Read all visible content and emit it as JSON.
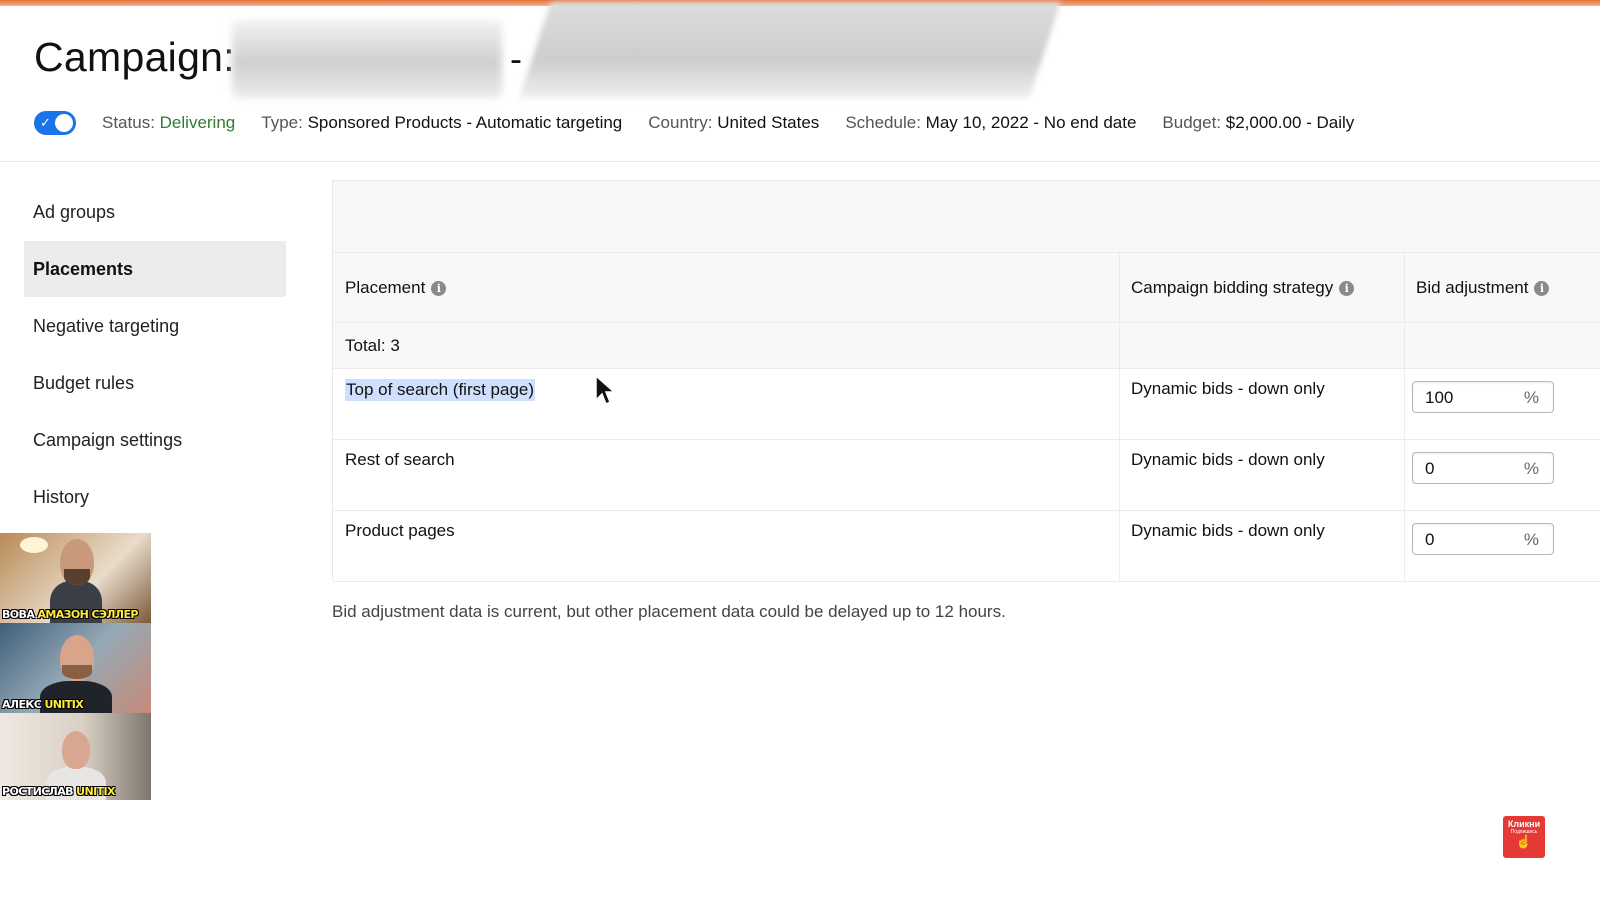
{
  "header": {
    "title": "Campaign:",
    "title_suffix": "-",
    "status_label": "Status:",
    "status_value": "Delivering",
    "type_label": "Type:",
    "type_value": "Sponsored Products - Automatic targeting",
    "country_label": "Country:",
    "country_value": "United States",
    "schedule_label": "Schedule:",
    "schedule_value": "May 10, 2022 - No end date",
    "budget_label": "Budget:",
    "budget_value": "$2,000.00 - Daily",
    "toggle_on": true,
    "toggle_color": "#1a73e8",
    "status_color": "#2f7d32"
  },
  "sidebar": {
    "items": [
      {
        "label": "Ad groups",
        "active": false
      },
      {
        "label": "Placements",
        "active": true
      },
      {
        "label": "Negative targeting",
        "active": false
      },
      {
        "label": "Budget rules",
        "active": false
      },
      {
        "label": "Campaign settings",
        "active": false
      },
      {
        "label": "History",
        "active": false
      }
    ]
  },
  "table": {
    "columns": {
      "placement": "Placement",
      "strategy": "Campaign bidding strategy",
      "bid": "Bid adjustment"
    },
    "total": "Total: 3",
    "rows": [
      {
        "placement": "Top of search (first page)",
        "strategy": "Dynamic bids - down only",
        "bid": "100",
        "unit": "%",
        "selected": true
      },
      {
        "placement": "Rest of search",
        "strategy": "Dynamic bids - down only",
        "bid": "0",
        "unit": "%",
        "selected": false
      },
      {
        "placement": "Product pages",
        "strategy": "Dynamic bids - down only",
        "bid": "0",
        "unit": "%",
        "selected": false
      }
    ]
  },
  "footnote": "Bid adjustment data is current, but other placement data could be delayed up to 12 hours.",
  "video_overlay": {
    "participants": [
      {
        "name": "ВОВА",
        "tag": "АМАЗОН СЭЛЛЕР"
      },
      {
        "name": "АЛЕКС",
        "tag": "UNITIX"
      },
      {
        "name": "РОСТИСЛАВ",
        "tag": "UNITIX"
      }
    ]
  },
  "subscribe_badge": {
    "label": "Кликни",
    "sublabel": "Подпишись"
  }
}
